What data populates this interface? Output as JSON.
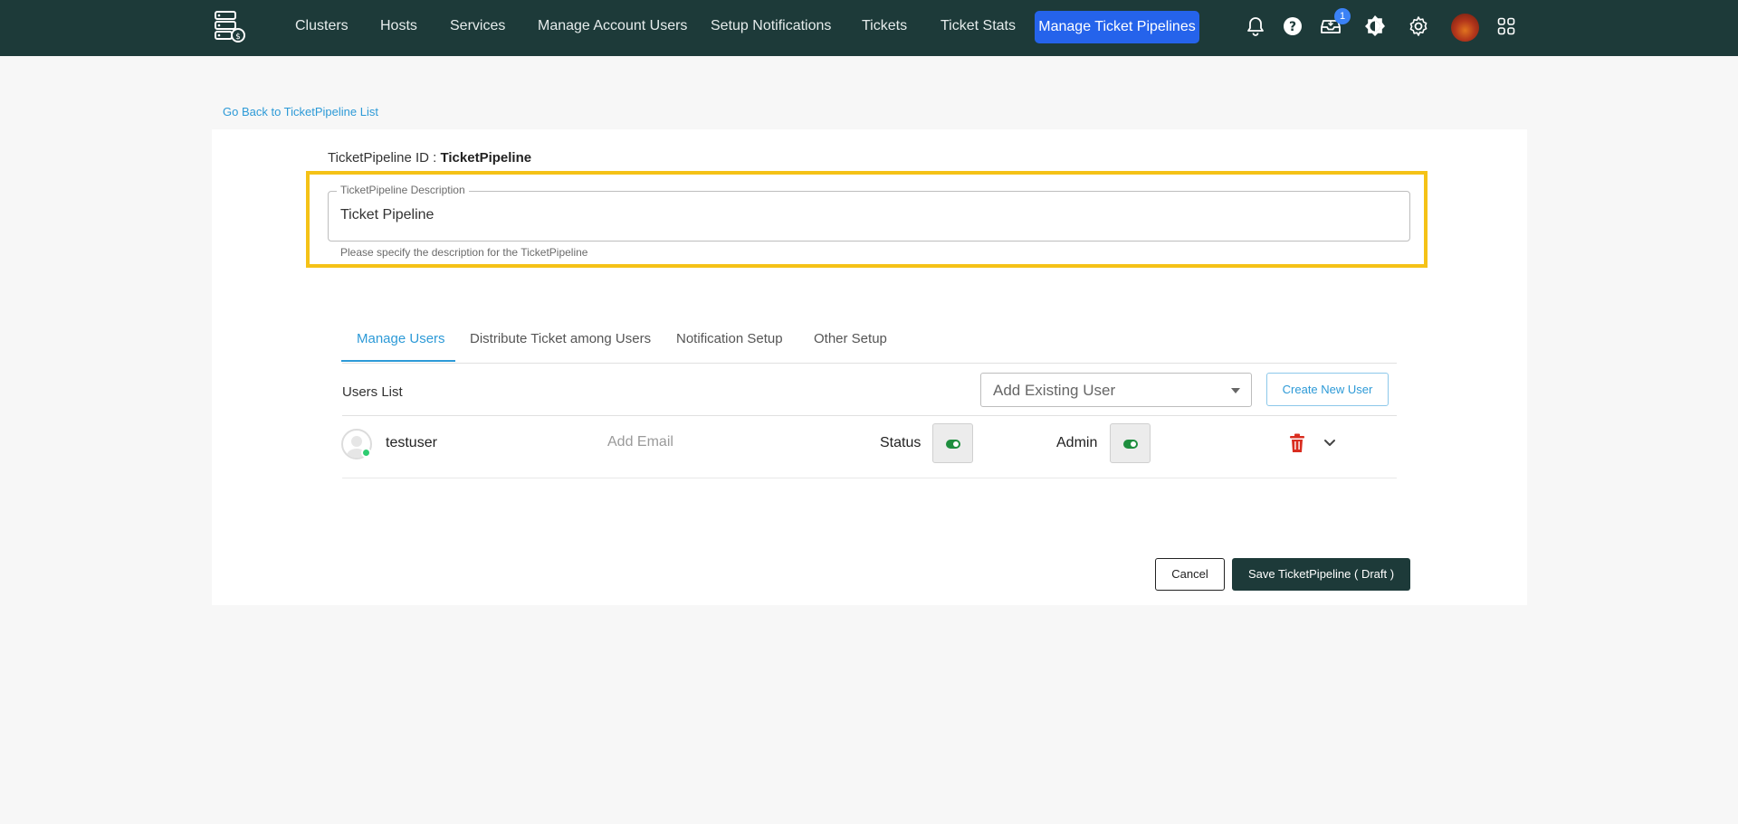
{
  "navbar": {
    "items": [
      "Clusters",
      "Hosts",
      "Services",
      "Manage Account Users",
      "Setup Notifications",
      "Tickets",
      "Ticket Stats"
    ],
    "active_item": "Manage Ticket Pipelines",
    "inbox_badge": "1",
    "icons": [
      "bell-icon",
      "help-icon",
      "inbox-icon",
      "theme-toggle-icon",
      "settings-icon",
      "user-avatar",
      "apps-grid-icon"
    ],
    "colors": {
      "background": "#1d3a39",
      "active": "#2563eb"
    }
  },
  "back_link": "Go Back to TicketPipeline List",
  "pipeline": {
    "id_label": "TicketPipeline ID : ",
    "id_value": "TicketPipeline",
    "description_label": "TicketPipeline Description",
    "description_value": "Ticket Pipeline",
    "description_help": "Please specify the description for the TicketPipeline"
  },
  "tabs": [
    "Manage Users",
    "Distribute Ticket among Users",
    "Notification Setup",
    "Other Setup"
  ],
  "users_section": {
    "title": "Users List",
    "add_existing_placeholder": "Add Existing User",
    "create_new_label": "Create New User",
    "users": [
      {
        "name": "testuser",
        "email_placeholder": "Add Email",
        "status_label": "Status",
        "status_on": true,
        "admin_label": "Admin",
        "admin_on": true
      }
    ]
  },
  "footer": {
    "cancel_label": "Cancel",
    "save_label": "Save TicketPipeline ( Draft )"
  },
  "highlight_color": "#f5c217"
}
